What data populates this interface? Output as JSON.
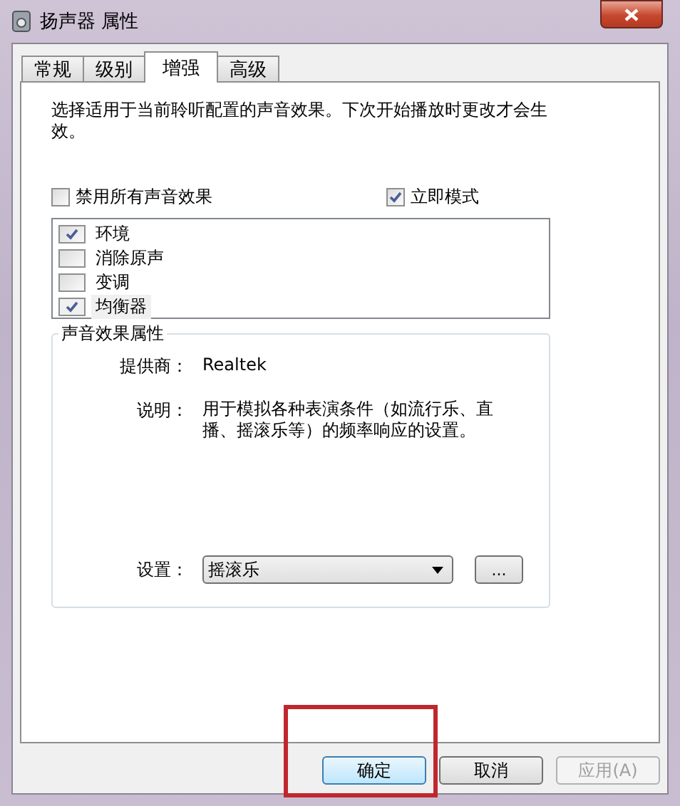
{
  "window": {
    "title": "扬声器 属性"
  },
  "tabs": [
    {
      "label": "常规",
      "selected": false
    },
    {
      "label": "级别",
      "selected": false
    },
    {
      "label": "增强",
      "selected": true
    },
    {
      "label": "高级",
      "selected": false
    }
  ],
  "description": "选择适用于当前聆听配置的声音效果。下次开始播放时更改才会生效。",
  "disable_all": {
    "label": "禁用所有声音效果",
    "checked": false
  },
  "immediate_mode": {
    "label": "立即模式",
    "checked": true
  },
  "effects": [
    {
      "label": "环境",
      "checked": true,
      "selected": false
    },
    {
      "label": "消除原声",
      "checked": false,
      "selected": false
    },
    {
      "label": "变调",
      "checked": false,
      "selected": false
    },
    {
      "label": "均衡器",
      "checked": true,
      "selected": true
    }
  ],
  "properties": {
    "title": "声音效果属性",
    "provider_label": "提供商：",
    "provider": "Realtek",
    "info_label": "说明：",
    "info": "用于模拟各种表演条件（如流行乐、直播、摇滚乐等）的频率响应的设置。",
    "setting_label": "设置：",
    "setting": "摇滚乐",
    "more": "..."
  },
  "buttons": [
    {
      "label": "确定",
      "disabled": false,
      "highlighted": true
    },
    {
      "label": "取消",
      "disabled": false,
      "highlighted": false
    },
    {
      "label": "应用(A)",
      "disabled": true,
      "highlighted": false
    }
  ]
}
